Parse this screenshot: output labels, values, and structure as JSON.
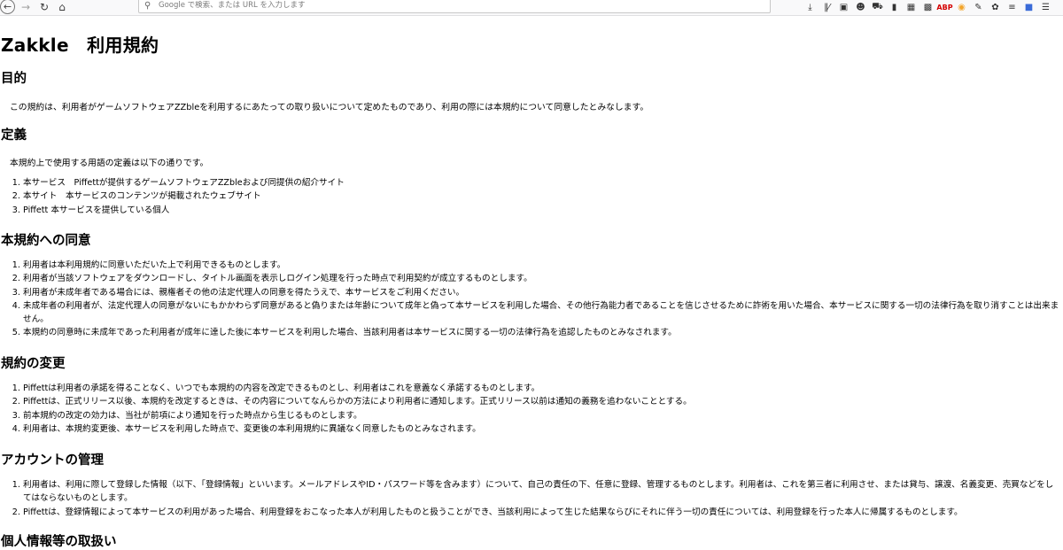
{
  "toolbar": {
    "url_placeholder": "Google で検索、または URL を入力します",
    "icons": [
      "download-icon",
      "library-icon",
      "reader-icon",
      "account-icon",
      "lock-icon",
      "bag-icon",
      "grid-icon",
      "container-icon",
      "adblock-icon",
      "extension-icon",
      "pen-icon",
      "leaf-icon",
      "settings-icon",
      "save-icon",
      "menu-icon"
    ],
    "adblock_label": "ABP"
  },
  "page": {
    "title": "Zakkle　利用規約",
    "sections": [
      {
        "heading": "目的",
        "text": "この規約は、利用者がゲームソフトウェアZZbleを利用するにあたっての取り扱いについて定めたものであり、利用の際には本規約について同意したとみなします。"
      },
      {
        "heading": "定義",
        "text": "本規約上で使用する用語の定義は以下の通りです。",
        "items": [
          "本サービス　Piffettが提供するゲームソフトウェアZZbleおよび同提供の紹介サイト",
          "本サイト　本サービスのコンテンツが掲載されたウェブサイト",
          "Piffett 本サービスを提供している個人"
        ]
      },
      {
        "heading": "本規約への同意",
        "items": [
          "利用者は本利用規約に同意いただいた上で利用できるものとします。",
          "利用者が当該ソフトウェアをダウンロードし、タイトル画面を表示しログイン処理を行った時点で利用契約が成立するものとします。",
          "利用者が未成年者である場合には、親権者その他の法定代理人の同意を得たうえで、本サービスをご利用ください。",
          "未成年者の利用者が、法定代理人の同意がないにもかかわらず同意があると偽りまたは年齢について成年と偽って本サービスを利用した場合、その他行為能力者であることを信じさせるために詐術を用いた場合、本サービスに関する一切の法律行為を取り消すことは出来ません。",
          "本規約の同意時に未成年であった利用者が成年に達した後に本サービスを利用した場合、当該利用者は本サービスに関する一切の法律行為を追認したものとみなされます。"
        ]
      },
      {
        "heading": "規約の変更",
        "items": [
          "Piffettは利用者の承諾を得ることなく、いつでも本規約の内容を改定できるものとし、利用者はこれを意義なく承諾するものとします。",
          "Piffettは、正式リリース以後、本規約を改定するときは、その内容についてなんらかの方法により利用者に通知します。正式リリース以前は通知の義務を追わないこととする。",
          "前本規約の改定の効力は、当社が前項により通知を行った時点から生じるものとします。",
          "利用者は、本規約変更後、本サービスを利用した時点で、変更後の本利用規約に異議なく同意したものとみなされます。"
        ]
      },
      {
        "heading": "アカウントの管理",
        "items": [
          "利用者は、利用に際して登録した情報（以下、「登録情報」といいます。メールアドレスやID・パスワード等を含みます）について、自己の責任の下、任意に登録、管理するものとします。利用者は、これを第三者に利用させ、または貸与、譲渡、名義変更、売買などをしてはならないものとします。",
          "Piffettは、登録情報によって本サービスの利用があった場合、利用登録をおこなった本人が利用したものと扱うことができ、当該利用によって生じた結果ならびにそれに伴う一切の責任については、利用登録を行った本人に帰属するものとします。"
        ]
      },
      {
        "heading": "個人情報等の取扱い"
      }
    ]
  }
}
